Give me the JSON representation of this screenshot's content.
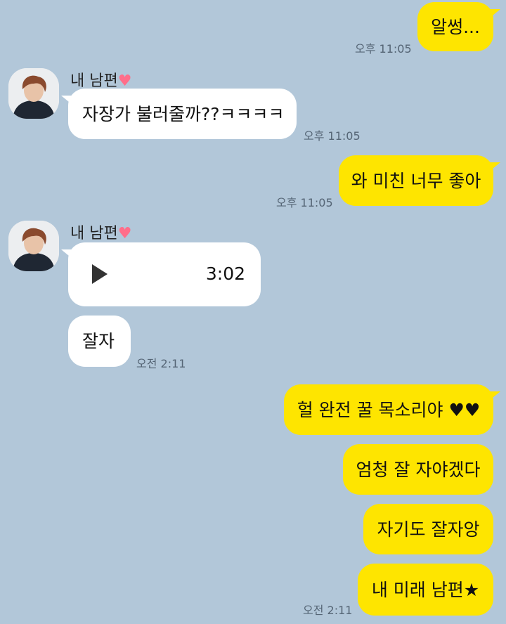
{
  "messages": {
    "m1": {
      "text": "알썽...",
      "time": "오후 11:05"
    },
    "m2": {
      "sender": "내 남편",
      "heart": "♥",
      "text": "자장가 불러줄까??ㅋㅋㅋㅋ",
      "time": "오후 11:05"
    },
    "m3": {
      "text": "와 미친 너무 좋아",
      "time": "오후 11:05"
    },
    "m4": {
      "sender": "내 남편",
      "heart": "♥",
      "voice_duration": "3:02",
      "play_icon": "play-icon"
    },
    "m5": {
      "text": "잘자",
      "time": "오전 2:11"
    },
    "m6": {
      "text": "헐 완전 꿀 목소리야 ♥♥"
    },
    "m7": {
      "text": "엄청 잘 자야겠다"
    },
    "m8": {
      "text": "자기도 잘자앙"
    },
    "m9": {
      "text": "내 미래 남편★",
      "time": "오전 2:11"
    }
  },
  "colors": {
    "background": "#b2c7d9",
    "my_bubble": "#fee500",
    "other_bubble": "#ffffff"
  }
}
